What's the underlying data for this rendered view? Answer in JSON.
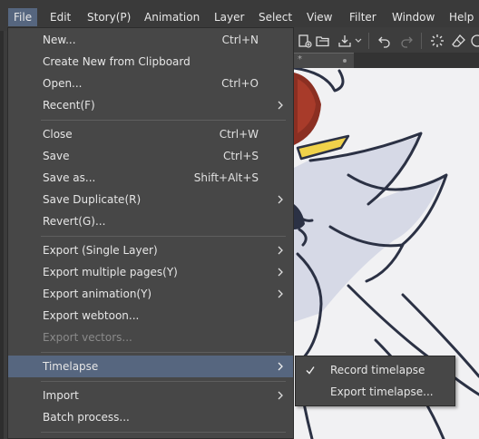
{
  "menubar": {
    "items": [
      "File",
      "Edit",
      "Story(P)",
      "Animation",
      "Layer",
      "Select",
      "View",
      "Filter",
      "Window",
      "Help"
    ]
  },
  "document_tab": {
    "title": "*"
  },
  "file_menu": {
    "items": [
      {
        "label": "New...",
        "shortcut": "Ctrl+N"
      },
      {
        "label": "Create New from Clipboard",
        "shortcut": ""
      },
      {
        "label": "Open...",
        "shortcut": "Ctrl+O"
      },
      {
        "label": "Recent(F)",
        "shortcut": ""
      },
      {
        "label": "Close",
        "shortcut": "Ctrl+W"
      },
      {
        "label": "Save",
        "shortcut": "Ctrl+S"
      },
      {
        "label": "Save as...",
        "shortcut": "Shift+Alt+S"
      },
      {
        "label": "Save Duplicate(R)",
        "shortcut": ""
      },
      {
        "label": "Revert(G)...",
        "shortcut": ""
      },
      {
        "label": "Export (Single Layer)",
        "shortcut": ""
      },
      {
        "label": "Export multiple pages(Y)",
        "shortcut": ""
      },
      {
        "label": "Export animation(Y)",
        "shortcut": ""
      },
      {
        "label": "Export webtoon...",
        "shortcut": ""
      },
      {
        "label": "Export vectors...",
        "shortcut": ""
      },
      {
        "label": "Timelapse",
        "shortcut": ""
      },
      {
        "label": "Import",
        "shortcut": ""
      },
      {
        "label": "Batch process...",
        "shortcut": ""
      }
    ]
  },
  "timelapse_submenu": {
    "items": [
      {
        "label": "Record timelapse",
        "checked": true
      },
      {
        "label": "Export timelapse...",
        "checked": false
      }
    ]
  },
  "icons": {
    "toolbar": [
      "new-page-icon",
      "open-folder-icon",
      "export-icon",
      "chevron-down-icon",
      "undo-icon",
      "redo-icon",
      "loading-spinner-icon",
      "eraser-icon"
    ],
    "menu": [
      "submenu-arrow-icon",
      "checkmark-icon"
    ]
  },
  "colors": {
    "menu_bg": "#474747",
    "highlight": "#56667f",
    "text": "#e6e6e6",
    "disabled_text": "#8a8a8a",
    "canvas": "#f1f1f3",
    "drawing_line": "#2b3144"
  }
}
